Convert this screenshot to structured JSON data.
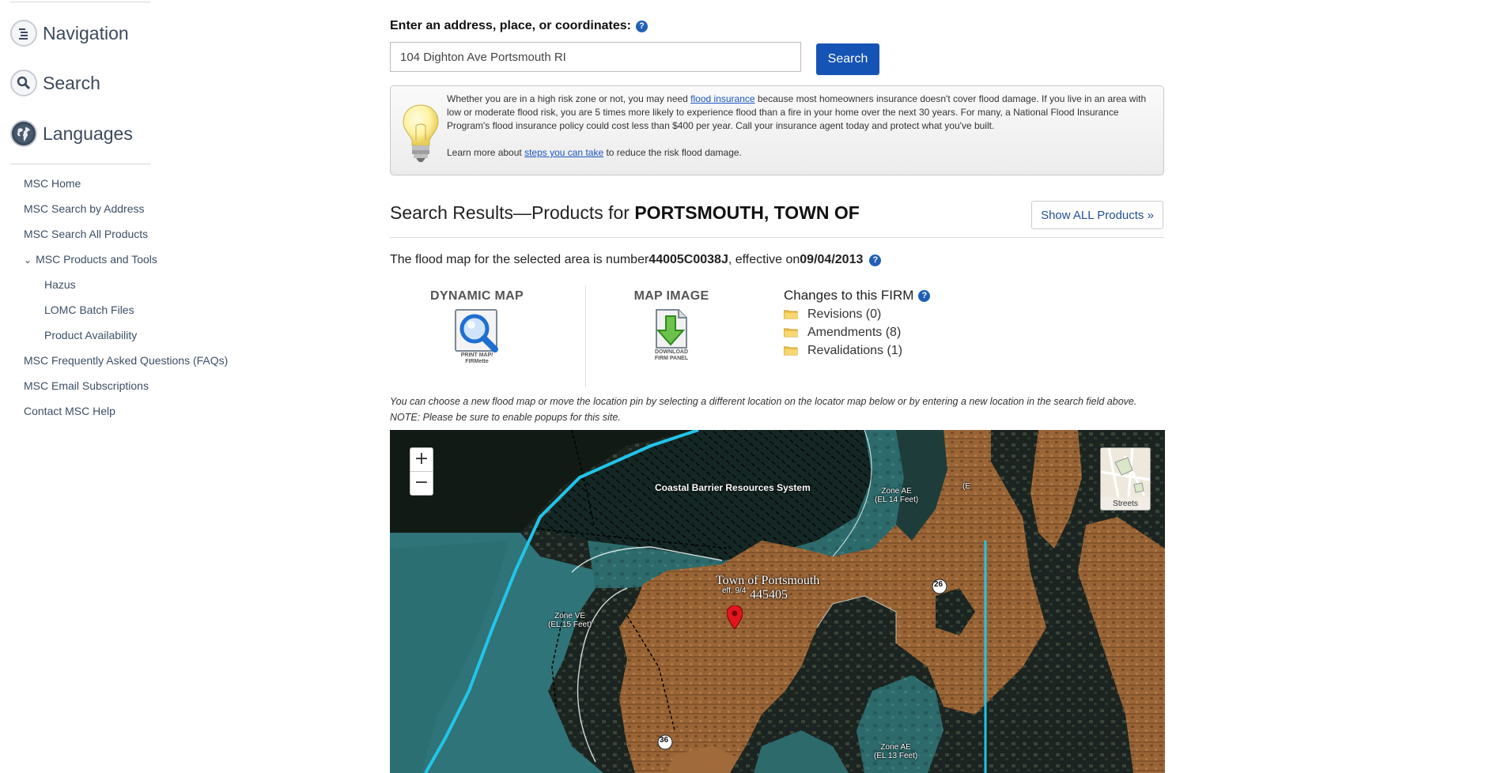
{
  "sidebar": {
    "sections": [
      {
        "label": "Navigation",
        "icon": "list-icon"
      },
      {
        "label": "Search",
        "icon": "magnifier-icon"
      },
      {
        "label": "Languages",
        "icon": "globe-icon"
      }
    ],
    "links": {
      "msc_home": "MSC Home",
      "search_by_address": "MSC Search by Address",
      "search_all_products": "MSC Search All Products",
      "products_and_tools": "MSC Products and Tools",
      "hazus": "Hazus",
      "lomc_batch": "LOMC Batch Files",
      "product_availability": "Product Availability",
      "faqs": "MSC Frequently Asked Questions (FAQs)",
      "email_subscriptions": "MSC Email Subscriptions",
      "contact": "Contact MSC Help"
    }
  },
  "search": {
    "label": "Enter an address, place, or coordinates:",
    "value": "104 Dighton Ave Portsmouth RI",
    "button": "Search"
  },
  "tip": {
    "line1_a": "Whether you are in a high risk zone or not, you may need ",
    "line1_link": "flood insurance",
    "line1_b": " because most homeowners insurance doesn't cover flood damage. If you live in an area with low or moderate flood risk, you are 5 times more likely to experience flood than a fire in your home over the next 30 years. For many, a National Flood Insurance Program's flood insurance policy could cost less than $400 per year. Call your insurance agent today and protect what you've built.",
    "line2_a": "Learn more about ",
    "line2_link": "steps you can take",
    "line2_b": " to reduce the risk flood damage."
  },
  "results": {
    "title_prefix": "Search Results—Products for ",
    "title_place": "PORTSMOUTH, TOWN OF",
    "show_all": "Show ALL Products »",
    "flood_prefix": "The flood map for the selected area is number ",
    "map_number": "44005C0038J",
    "flood_mid": ", effective on ",
    "effective_date": "09/04/2013"
  },
  "products": {
    "dynamic_title": "DYNAMIC MAP",
    "dynamic_caption_1": "PRINT MAP/",
    "dynamic_caption_2": "FIRMette",
    "image_title": "MAP IMAGE",
    "image_caption_1": "DOWNLOAD",
    "image_caption_2": "FIRM PANEL"
  },
  "firm_changes": {
    "title": "Changes to this FIRM",
    "items": [
      "Revisions (0)",
      "Amendments (8)",
      "Revalidations (1)"
    ]
  },
  "note": "You can choose a new flood map or move the location pin by selecting a different location on the locator map below or by entering a new location in the search field above. NOTE: Please be sure to enable popups for this site.",
  "map": {
    "zoom_in": "+",
    "zoom_out": "−",
    "basemap": "Streets",
    "cbrs": "Coastal Barrier Resources System",
    "zone_ae_top_1": "Zone AE",
    "zone_ae_top_2": "(EL 14 Feet)",
    "zone_ve_1": "Zone VE",
    "zone_ve_2": "(EL 15 Feet)",
    "zone_ae_bottom_1": "Zone AE",
    "zone_ae_bottom_2": "(EL 13 Feet)",
    "town_1": "Town of Portsmouth",
    "town_2": "445405",
    "town_eff": "eff. 9/4",
    "route_26": "26",
    "route_36": "36",
    "partial_b": "(E"
  }
}
